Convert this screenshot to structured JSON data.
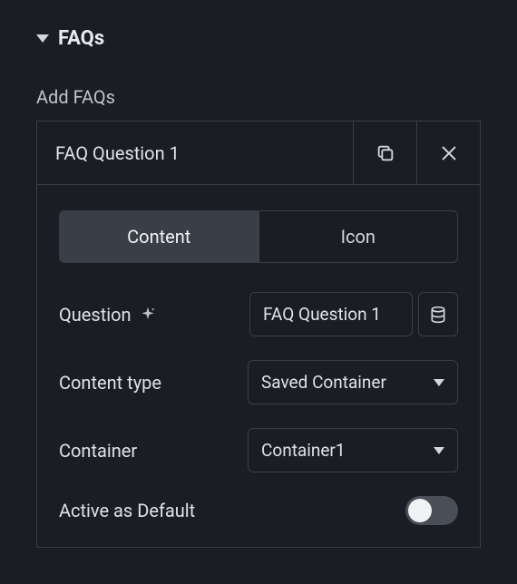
{
  "accordion": {
    "title": "FAQs"
  },
  "section": {
    "label": "Add FAQs"
  },
  "faq": {
    "header_title": "FAQ Question 1",
    "tabs": {
      "content": "Content",
      "icon": "Icon"
    },
    "fields": {
      "question_label": "Question",
      "question_value": "FAQ Question 1",
      "content_type_label": "Content type",
      "content_type_value": "Saved Container",
      "container_label": "Container",
      "container_value": "Container1",
      "active_default_label": "Active as Default"
    },
    "toggle": {
      "active_default": false
    }
  }
}
